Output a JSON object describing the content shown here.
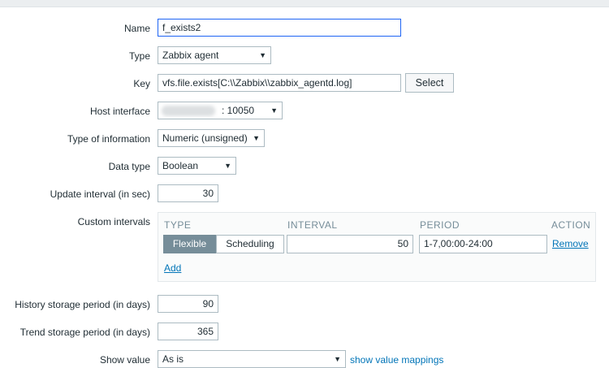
{
  "form": {
    "name": {
      "label": "Name",
      "value": "f_exists2"
    },
    "type": {
      "label": "Type",
      "value": "Zabbix agent"
    },
    "key": {
      "label": "Key",
      "value": "vfs.file.exists[C:\\\\Zabbix\\\\zabbix_agentd.log]",
      "select_button": "Select"
    },
    "host_interface": {
      "label": "Host interface",
      "value": ": 10050"
    },
    "type_of_information": {
      "label": "Type of information",
      "value": "Numeric (unsigned)"
    },
    "data_type": {
      "label": "Data type",
      "value": "Boolean"
    },
    "update_interval": {
      "label": "Update interval (in sec)",
      "value": "30"
    },
    "custom_intervals": {
      "label": "Custom intervals",
      "headers": {
        "type": "TYPE",
        "interval": "INTERVAL",
        "period": "PERIOD",
        "action": "ACTION"
      },
      "row": {
        "type_flexible": "Flexible",
        "type_scheduling": "Scheduling",
        "interval": "50",
        "period": "1-7,00:00-24:00",
        "remove": "Remove"
      },
      "add": "Add"
    },
    "history": {
      "label": "History storage period (in days)",
      "value": "90"
    },
    "trend": {
      "label": "Trend storage period (in days)",
      "value": "365"
    },
    "show_value": {
      "label": "Show value",
      "value": "As is",
      "mappings_link": "show value mappings"
    }
  },
  "icons": {
    "dropdown": "chevron-down-icon"
  },
  "colors": {
    "accent": "#0275b8",
    "segment_active": "#768d99",
    "focus_border": "#1f65f4"
  }
}
